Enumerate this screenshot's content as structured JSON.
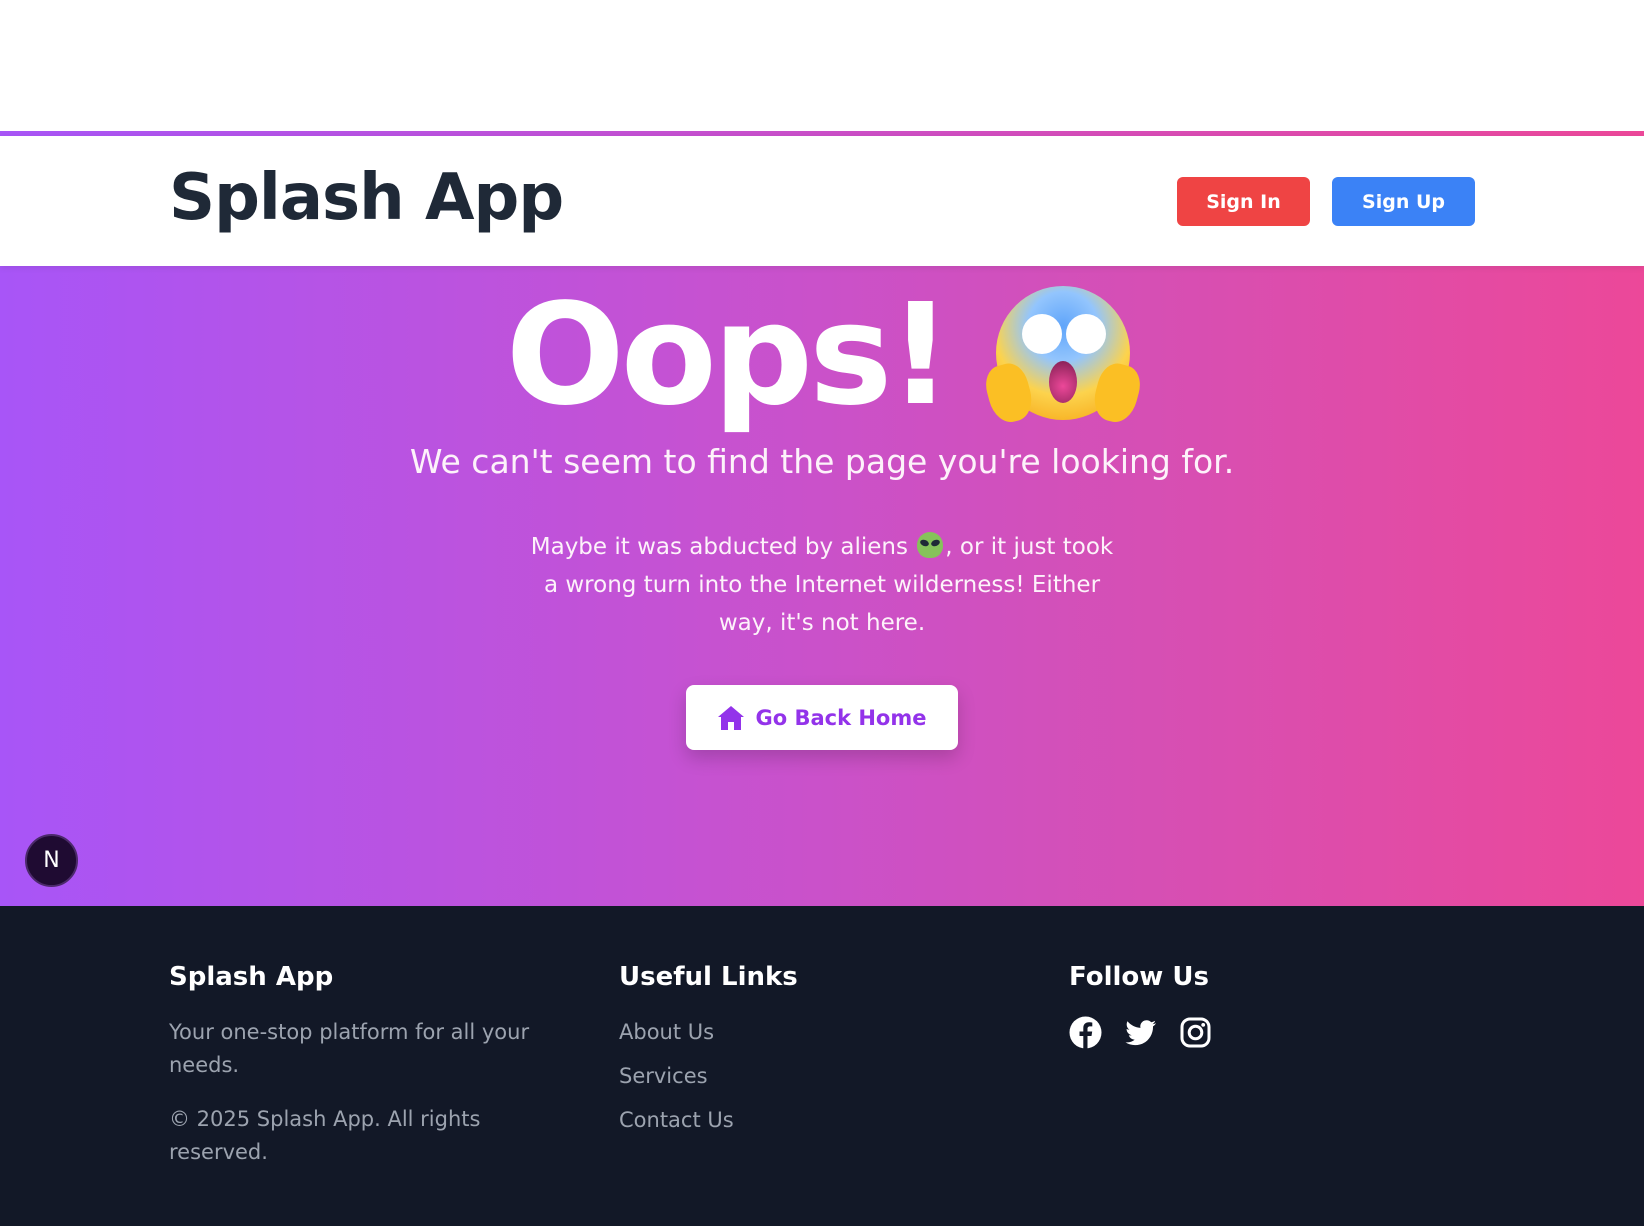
{
  "header": {
    "brand": "Splash App",
    "sign_in_label": "Sign In",
    "sign_up_label": "Sign Up"
  },
  "hero": {
    "title": "Oops!",
    "title_emoji": "face-screaming-in-fear",
    "subtitle": "We can't seem to find the page you're looking for.",
    "body_part1": "Maybe it was abducted by aliens",
    "body_emoji": "alien",
    "body_part2": ", or it just took a wrong turn into the Internet wilderness! Either way, it's not here.",
    "home_button_label": "Go Back Home",
    "home_button_icon": "home-icon"
  },
  "badge": {
    "label": "N"
  },
  "footer": {
    "brand_heading": "Splash App",
    "tagline": "Your one-stop platform for all your needs.",
    "copyright": "© 2025 Splash App. All rights reserved.",
    "links_heading": "Useful Links",
    "links": [
      {
        "label": "About Us"
      },
      {
        "label": "Services"
      },
      {
        "label": "Contact Us"
      }
    ],
    "follow_heading": "Follow Us",
    "social": [
      "facebook-icon",
      "twitter-icon",
      "instagram-icon"
    ]
  },
  "colors": {
    "sign_in": "#ef4444",
    "sign_up": "#3b82f6",
    "gradient_start": "#a855f7",
    "gradient_end": "#ec4899",
    "footer_bg": "#121827",
    "home_button_text": "#9333ea"
  }
}
